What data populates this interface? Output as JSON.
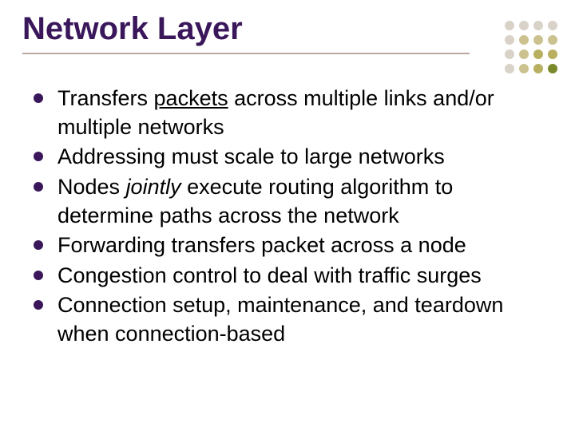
{
  "title": "Network Layer",
  "bullets": [
    {
      "pre": "Transfers ",
      "em": "packets",
      "em_style": "underline",
      "post": " across multiple links and/or multiple networks"
    },
    {
      "pre": "Addressing must scale to large networks",
      "em": "",
      "em_style": "",
      "post": ""
    },
    {
      "pre": "Nodes ",
      "em": "jointly",
      "em_style": "italic",
      "post": " execute routing algorithm to determine paths across the network"
    },
    {
      "pre": "Forwarding transfers packet across a node",
      "em": "",
      "em_style": "",
      "post": ""
    },
    {
      "pre": "Congestion control to deal with traffic surges",
      "em": "",
      "em_style": "",
      "post": ""
    },
    {
      "pre": "Connection setup, maintenance, and teardown when connection-based",
      "em": "",
      "em_style": "",
      "post": ""
    }
  ],
  "decor": {
    "dot_colors": [
      "#d9d2c8",
      "#d9d2c8",
      "#d9d2c8",
      "#d9d2c8",
      "#d9d2c8",
      "#ccc28f",
      "#ccc28f",
      "#ccc28f",
      "#d9d2c8",
      "#ccc28f",
      "#b8b060",
      "#b8b060",
      "#d9d2c8",
      "#ccc28f",
      "#b8b060",
      "#7a8a2a"
    ]
  }
}
